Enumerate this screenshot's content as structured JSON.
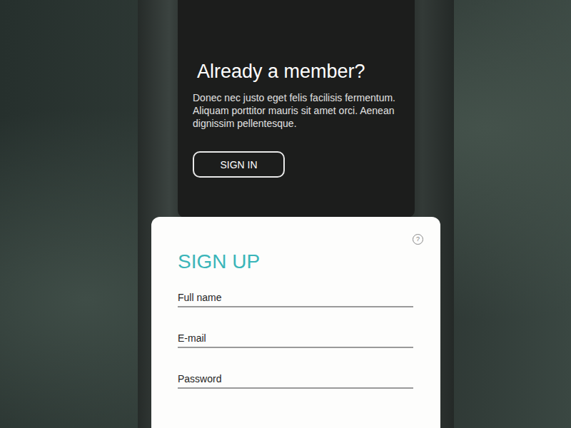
{
  "sign_in_panel": {
    "title": "Already a member?",
    "description": "Donec nec justo eget felis facilisis fermentum. Aliquam porttitor mauris sit amet orci. Aenean dignissim pellentesque.",
    "button": "SIGN IN"
  },
  "sign_up_form": {
    "help_icon": "?",
    "title": "SIGN UP",
    "fields": [
      {
        "label": "Full name"
      },
      {
        "label": "E-mail"
      },
      {
        "label": "Password"
      }
    ]
  }
}
